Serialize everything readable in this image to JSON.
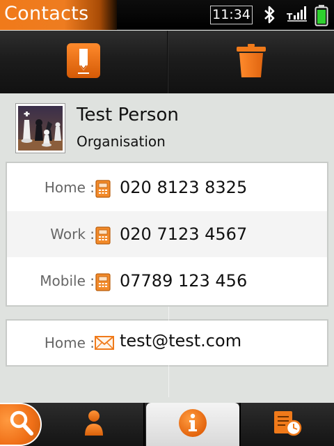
{
  "status_bar": {
    "app_title": "Contacts",
    "time": "11:34",
    "icons": [
      "bluetooth-icon",
      "signal-icon",
      "battery-icon"
    ]
  },
  "toolbar": {
    "actions": [
      {
        "name": "edit",
        "icon": "edit-icon"
      },
      {
        "name": "delete",
        "icon": "trash-icon"
      }
    ]
  },
  "contact": {
    "name": "Test Person",
    "organisation": "Organisation",
    "avatar": "chess-pieces-photo"
  },
  "phones": [
    {
      "label": "Home :",
      "value": "020 8123 8325",
      "icon": "phone-icon"
    },
    {
      "label": "Work :",
      "value": "020 7123 4567",
      "icon": "phone-icon"
    },
    {
      "label": "Mobile :",
      "value": "07789 123 456",
      "icon": "phone-icon"
    }
  ],
  "emails": [
    {
      "label": "Home :",
      "value": "test@test.com",
      "icon": "envelope-icon"
    }
  ],
  "bottom_nav": {
    "items": [
      "search",
      "contact",
      "details",
      "history"
    ],
    "active": "details"
  },
  "colors": {
    "accent": "#f07a1a",
    "background": "#dfe2df",
    "toolbar": "#1c1c1c"
  }
}
